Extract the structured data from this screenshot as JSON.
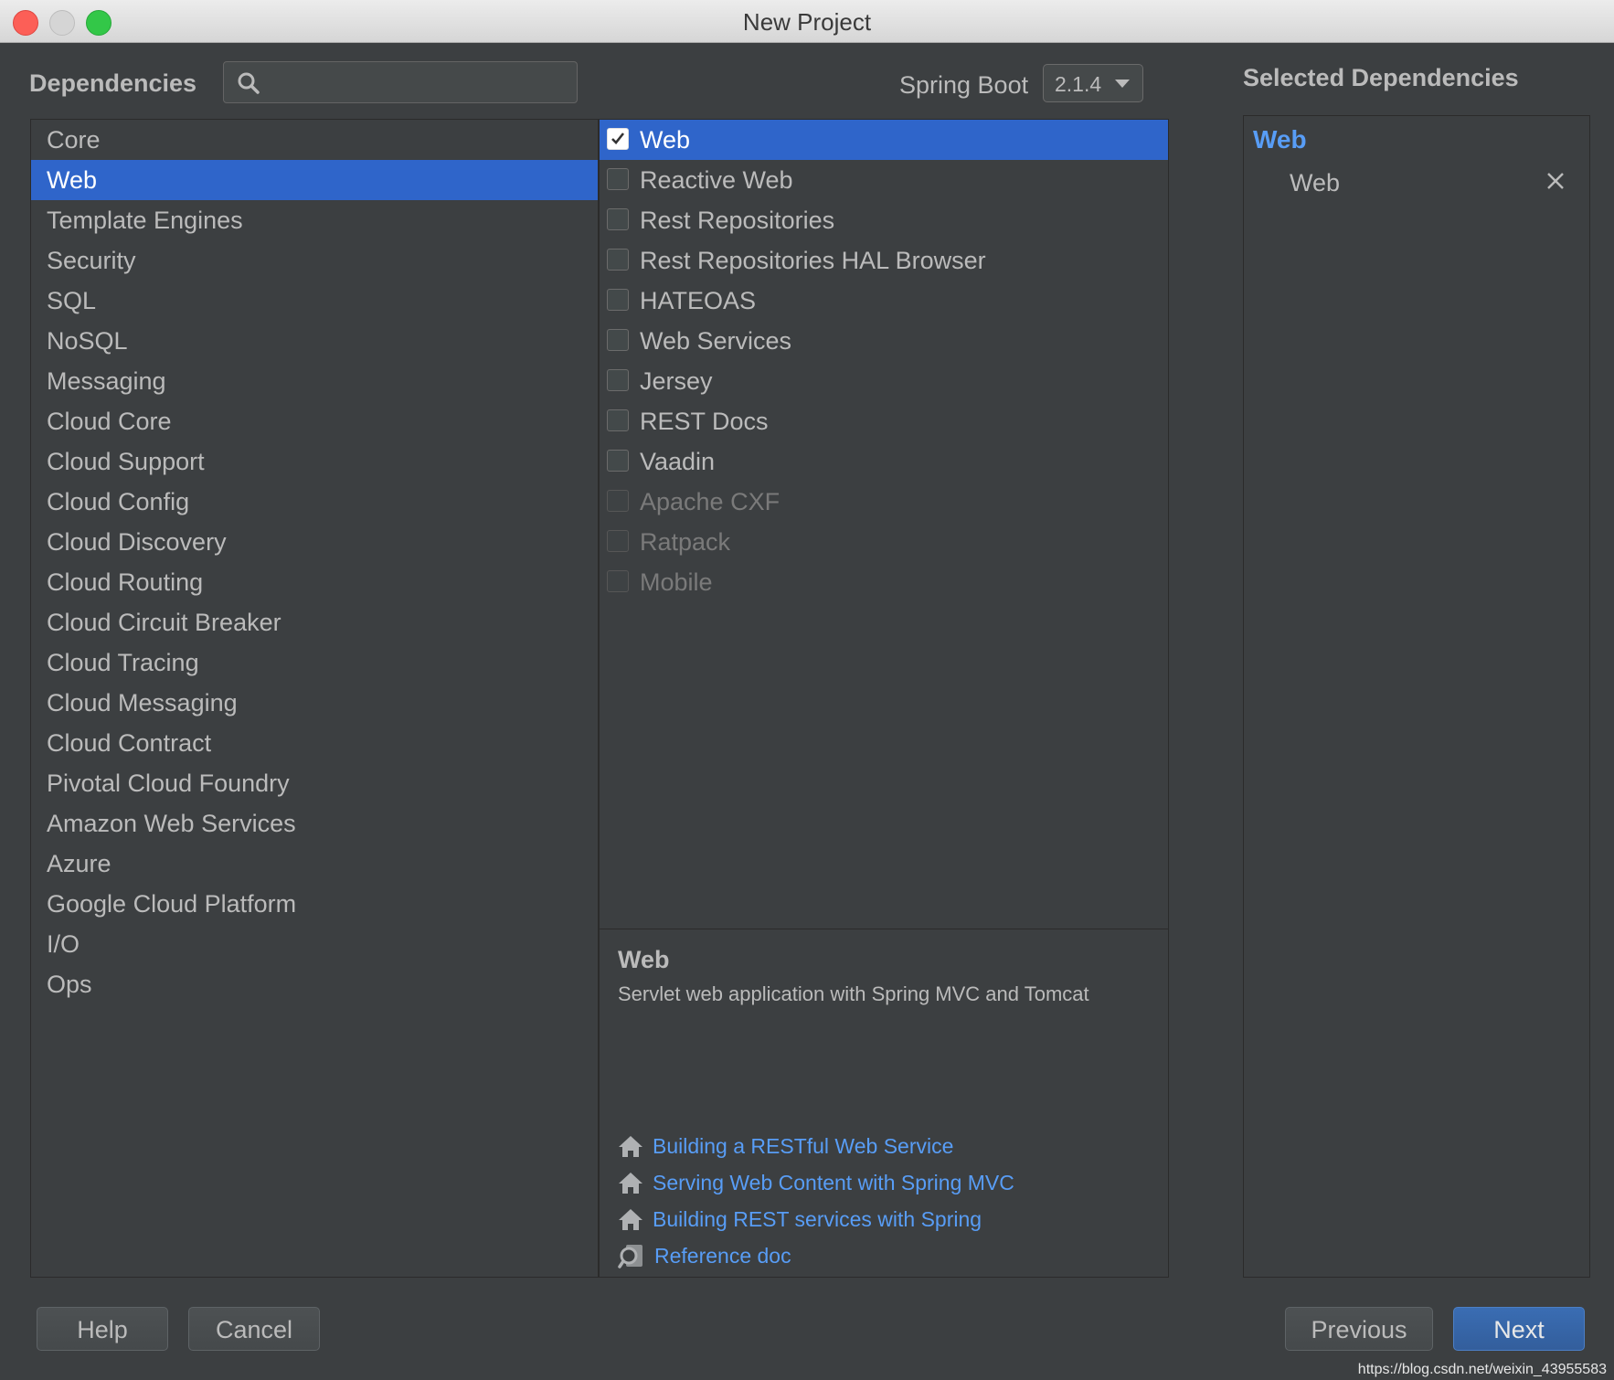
{
  "window": {
    "title": "New Project"
  },
  "header": {
    "dependencies_label": "Dependencies",
    "search": {
      "value": "",
      "placeholder": ""
    },
    "spring_boot_label": "Spring Boot",
    "spring_boot_version": "2.1.4",
    "selected_dependencies_label": "Selected Dependencies"
  },
  "categories": [
    {
      "label": "Core",
      "selected": false
    },
    {
      "label": "Web",
      "selected": true
    },
    {
      "label": "Template Engines",
      "selected": false
    },
    {
      "label": "Security",
      "selected": false
    },
    {
      "label": "SQL",
      "selected": false
    },
    {
      "label": "NoSQL",
      "selected": false
    },
    {
      "label": "Messaging",
      "selected": false
    },
    {
      "label": "Cloud Core",
      "selected": false
    },
    {
      "label": "Cloud Support",
      "selected": false
    },
    {
      "label": "Cloud Config",
      "selected": false
    },
    {
      "label": "Cloud Discovery",
      "selected": false
    },
    {
      "label": "Cloud Routing",
      "selected": false
    },
    {
      "label": "Cloud Circuit Breaker",
      "selected": false
    },
    {
      "label": "Cloud Tracing",
      "selected": false
    },
    {
      "label": "Cloud Messaging",
      "selected": false
    },
    {
      "label": "Cloud Contract",
      "selected": false
    },
    {
      "label": "Pivotal Cloud Foundry",
      "selected": false
    },
    {
      "label": "Amazon Web Services",
      "selected": false
    },
    {
      "label": "Azure",
      "selected": false
    },
    {
      "label": "Google Cloud Platform",
      "selected": false
    },
    {
      "label": "I/O",
      "selected": false
    },
    {
      "label": "Ops",
      "selected": false
    }
  ],
  "dependencies": [
    {
      "label": "Web",
      "checked": true,
      "enabled": true,
      "selected": true
    },
    {
      "label": "Reactive Web",
      "checked": false,
      "enabled": true,
      "selected": false
    },
    {
      "label": "Rest Repositories",
      "checked": false,
      "enabled": true,
      "selected": false
    },
    {
      "label": "Rest Repositories HAL Browser",
      "checked": false,
      "enabled": true,
      "selected": false
    },
    {
      "label": "HATEOAS",
      "checked": false,
      "enabled": true,
      "selected": false
    },
    {
      "label": "Web Services",
      "checked": false,
      "enabled": true,
      "selected": false
    },
    {
      "label": "Jersey",
      "checked": false,
      "enabled": true,
      "selected": false
    },
    {
      "label": "REST Docs",
      "checked": false,
      "enabled": true,
      "selected": false
    },
    {
      "label": "Vaadin",
      "checked": false,
      "enabled": true,
      "selected": false
    },
    {
      "label": "Apache CXF",
      "checked": false,
      "enabled": false,
      "selected": false
    },
    {
      "label": "Ratpack",
      "checked": false,
      "enabled": false,
      "selected": false
    },
    {
      "label": "Mobile",
      "checked": false,
      "enabled": false,
      "selected": false
    }
  ],
  "description": {
    "title": "Web",
    "text": "Servlet web application with Spring MVC and Tomcat",
    "links": [
      {
        "label": "Building a RESTful Web Service",
        "icon": "home-icon"
      },
      {
        "label": "Serving Web Content with Spring MVC",
        "icon": "home-icon"
      },
      {
        "label": "Building REST services with Spring",
        "icon": "home-icon"
      },
      {
        "label": "Reference doc",
        "icon": "reference-doc-icon"
      }
    ]
  },
  "selected": {
    "group": "Web",
    "items": [
      {
        "label": "Web"
      }
    ]
  },
  "buttons": {
    "help": "Help",
    "cancel": "Cancel",
    "previous": "Previous",
    "next": "Next"
  },
  "watermark": "https://blog.csdn.net/weixin_43955583",
  "colors": {
    "background": "#3c3f41",
    "selection": "#2f65ca",
    "link": "#589df6",
    "text": "#bbbbbb",
    "disabled_text": "#7a7a7a"
  }
}
